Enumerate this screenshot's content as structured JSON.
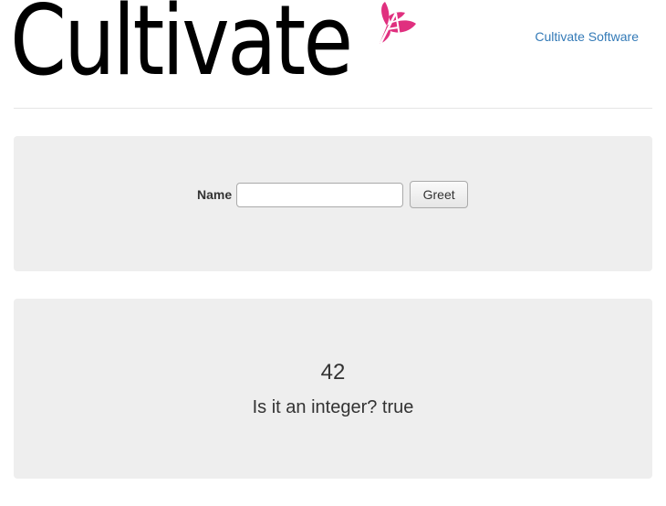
{
  "header": {
    "logo_text": "Cultivate",
    "nav_link_label": "Cultivate Software",
    "logo_accent_color": "#e0307f"
  },
  "form": {
    "name_label": "Name",
    "name_value": "",
    "name_placeholder": "",
    "greet_button_label": "Greet"
  },
  "result": {
    "number": "42",
    "is_integer_text": "Is it an integer? true"
  }
}
